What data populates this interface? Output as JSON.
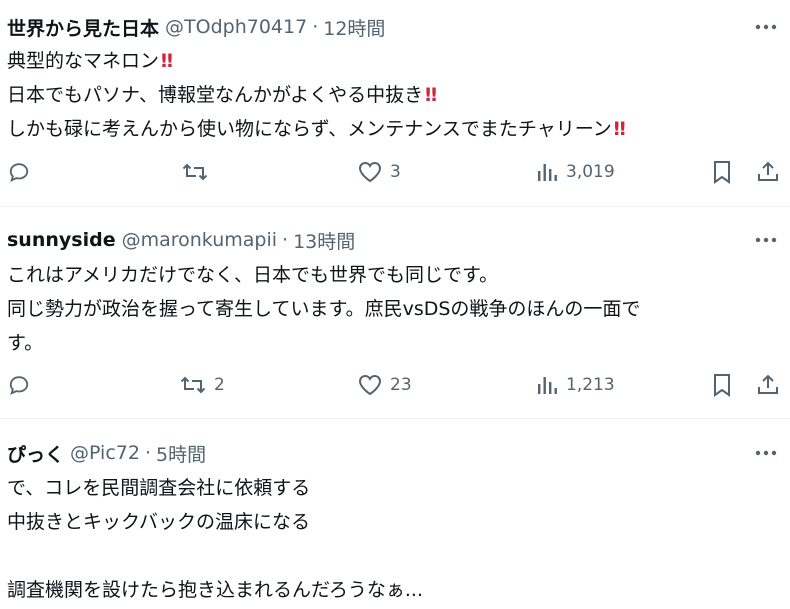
{
  "posts": [
    {
      "name": "世界から見た日本",
      "handle": "@TOdph70417",
      "time": "12時間",
      "lines": [
        {
          "text": "典型的なマネロン",
          "excl": "‼"
        },
        {
          "text": "日本でもパソナ、博報堂なんかがよくやる中抜き",
          "excl": "‼"
        },
        {
          "text": "しかも碌に考えんから使い物にならず、メンテナンスでまたチャリーン",
          "excl": "‼"
        }
      ],
      "stats": {
        "replies": "",
        "reposts": "",
        "likes": "3",
        "views": "3,019"
      }
    },
    {
      "name": "sunnyside",
      "handle": "@maronkumapii",
      "time": "13時間",
      "lines": [
        {
          "text": "これはアメリカだけでなく、日本でも世界でも同じです。"
        },
        {
          "text": "同じ勢力が政治を握って寄生しています。庶民vsDSの戦争のほんの一面で"
        },
        {
          "text": "す。"
        }
      ],
      "stats": {
        "replies": "",
        "reposts": "2",
        "likes": "23",
        "views": "1,213"
      }
    },
    {
      "name": "ぴっく",
      "handle": "@Pic72",
      "time": "5時間",
      "lines": [
        {
          "text": "で、コレを民間調査会社に依頼する"
        },
        {
          "text": "中抜きとキックバックの温床になる"
        },
        {
          "text": ""
        },
        {
          "text": "調査機関を設けたら抱き込まれるんだろうなぁ..."
        }
      ],
      "stats": {}
    }
  ],
  "separator": "·",
  "colors": {
    "text": "#0f1419",
    "muted": "#536471",
    "exclamation": "#d0243c",
    "divider": "#eff3f4"
  },
  "icons": [
    "reply-icon",
    "repost-icon",
    "like-icon",
    "views-icon",
    "bookmark-icon",
    "share-icon",
    "more-icon"
  ]
}
